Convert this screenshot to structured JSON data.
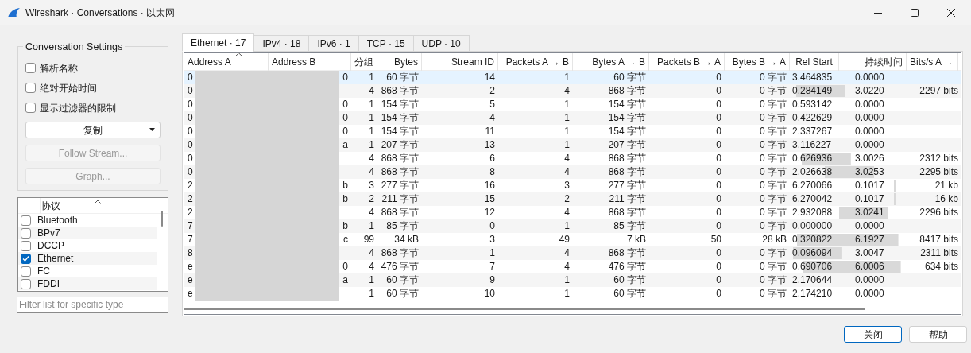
{
  "window": {
    "title": "Wireshark · Conversations · 以太网"
  },
  "settings": {
    "title": "Conversation Settings",
    "options": [
      {
        "label": "解析名称",
        "checked": false
      },
      {
        "label": "绝对开始时间",
        "checked": false
      },
      {
        "label": "显示过滤器的限制",
        "checked": false
      }
    ],
    "copy_button": "复制",
    "buttons": [
      {
        "label": "Follow Stream...",
        "disabled": true
      },
      {
        "label": "Graph...",
        "disabled": true
      }
    ]
  },
  "protocol_list": {
    "column": "协议",
    "items": [
      {
        "label": "Bluetooth",
        "checked": false
      },
      {
        "label": "BPv7",
        "checked": false
      },
      {
        "label": "DCCP",
        "checked": false
      },
      {
        "label": "Ethernet",
        "checked": true
      },
      {
        "label": "FC",
        "checked": false
      },
      {
        "label": "FDDI",
        "checked": false
      }
    ]
  },
  "filter": {
    "placeholder": "Filter list for specific type"
  },
  "tabs": [
    {
      "label": "Ethernet · 17",
      "selected": true
    },
    {
      "label": "IPv4 · 18",
      "selected": false
    },
    {
      "label": "IPv6 · 1",
      "selected": false
    },
    {
      "label": "TCP · 15",
      "selected": false
    },
    {
      "label": "UDP · 10",
      "selected": false
    }
  ],
  "table": {
    "columns": [
      "Address A",
      "Address B",
      "分组",
      "Bytes",
      "Stream ID",
      "Packets A → B",
      "Bytes A → B",
      "Packets B → A",
      "Bytes B → A",
      "Rel Start",
      "持续时间",
      "Bits/s A →"
    ],
    "rows": [
      {
        "selected": true,
        "cells": [
          "0",
          "0",
          "1",
          "60 字节",
          "14",
          "1",
          "60 字节",
          "0",
          "0 字节",
          "3.464835",
          "0.0000",
          ""
        ]
      },
      {
        "selected": false,
        "cells": [
          "0",
          "",
          "4",
          "868 字节",
          "2",
          "4",
          "868 字节",
          "0",
          "0 字节",
          "0.284149",
          "3.0220",
          "2297 bits"
        ]
      },
      {
        "selected": false,
        "cells": [
          "0",
          "0",
          "1",
          "154 字节",
          "5",
          "1",
          "154 字节",
          "0",
          "0 字节",
          "0.593142",
          "0.0000",
          ""
        ]
      },
      {
        "selected": false,
        "cells": [
          "0",
          "0",
          "1",
          "154 字节",
          "4",
          "1",
          "154 字节",
          "0",
          "0 字节",
          "0.422629",
          "0.0000",
          ""
        ]
      },
      {
        "selected": false,
        "cells": [
          "0",
          "0",
          "1",
          "154 字节",
          "11",
          "1",
          "154 字节",
          "0",
          "0 字节",
          "2.337267",
          "0.0000",
          ""
        ]
      },
      {
        "selected": false,
        "cells": [
          "0",
          "a",
          "1",
          "207 字节",
          "13",
          "1",
          "207 字节",
          "0",
          "0 字节",
          "3.116227",
          "0.0000",
          ""
        ]
      },
      {
        "selected": false,
        "cells": [
          "0",
          "",
          "4",
          "868 字节",
          "6",
          "4",
          "868 字节",
          "0",
          "0 字节",
          "0.626936",
          "3.0026",
          "2312 bits"
        ]
      },
      {
        "selected": false,
        "cells": [
          "0",
          "",
          "4",
          "868 字节",
          "8",
          "4",
          "868 字节",
          "0",
          "0 字节",
          "2.026638",
          "3.0253",
          "2295 bits"
        ]
      },
      {
        "selected": false,
        "cells": [
          "2",
          "b",
          "3",
          "277 字节",
          "16",
          "3",
          "277 字节",
          "0",
          "0 字节",
          "6.270066",
          "0.1017",
          "21 kb"
        ]
      },
      {
        "selected": false,
        "cells": [
          "2",
          "b",
          "2",
          "211 字节",
          "15",
          "2",
          "211 字节",
          "0",
          "0 字节",
          "6.270042",
          "0.1017",
          "16 kb"
        ]
      },
      {
        "selected": false,
        "cells": [
          "2",
          "",
          "4",
          "868 字节",
          "12",
          "4",
          "868 字节",
          "0",
          "0 字节",
          "2.932088",
          "3.0241",
          "2296 bits"
        ]
      },
      {
        "selected": false,
        "cells": [
          "7",
          "b",
          "1",
          "85 字节",
          "0",
          "1",
          "85 字节",
          "0",
          "0 字节",
          "0.000000",
          "0.0000",
          ""
        ]
      },
      {
        "selected": false,
        "cells": [
          "7",
          "c",
          "99",
          "34 kB",
          "3",
          "49",
          "7 kB",
          "50",
          "28 kB",
          "0.320822",
          "6.1927",
          "8417 bits"
        ]
      },
      {
        "selected": false,
        "cells": [
          "8",
          "",
          "4",
          "868 字节",
          "1",
          "4",
          "868 字节",
          "0",
          "0 字节",
          "0.096094",
          "3.0047",
          "2311 bits"
        ]
      },
      {
        "selected": false,
        "cells": [
          "e",
          "0",
          "4",
          "476 字节",
          "7",
          "4",
          "476 字节",
          "0",
          "0 字节",
          "0.690706",
          "6.0006",
          "634 bits"
        ]
      },
      {
        "selected": false,
        "cells": [
          "e",
          "a",
          "1",
          "60 字节",
          "9",
          "1",
          "60 字节",
          "0",
          "0 字节",
          "2.170644",
          "0.0000",
          ""
        ]
      },
      {
        "selected": false,
        "cells": [
          "e",
          "",
          "1",
          "60 字节",
          "10",
          "1",
          "60 字节",
          "0",
          "0 字节",
          "2.174210",
          "0.0000",
          ""
        ]
      }
    ]
  },
  "buttons": [
    {
      "label": "关闭",
      "default": true
    },
    {
      "label": "帮助",
      "default": false
    }
  ]
}
